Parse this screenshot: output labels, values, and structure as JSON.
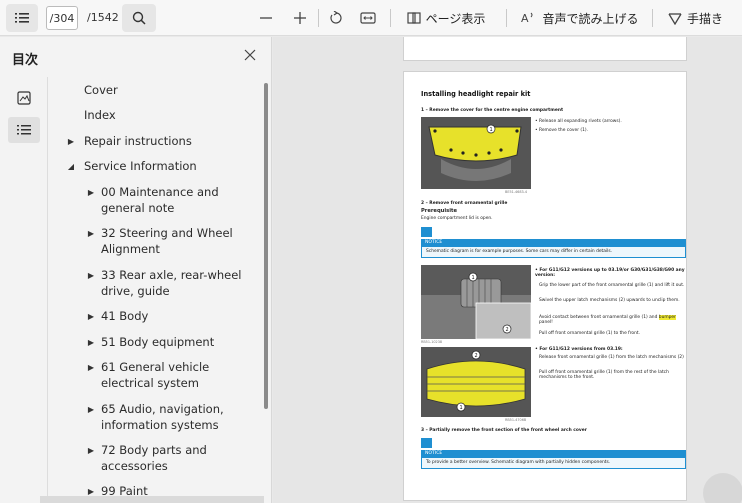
{
  "toolbar": {
    "current_page": "/304",
    "total_pages": "/1542",
    "page_view_label": "ページ表示",
    "read_aloud_label": "音声で読み上げる",
    "draw_label": "手描き"
  },
  "sidebar": {
    "title": "目次",
    "items": [
      {
        "label": "Cover",
        "arrow": ""
      },
      {
        "label": "Index",
        "arrow": ""
      },
      {
        "label": "Repair instructions",
        "arrow": "right"
      },
      {
        "label": "Service Information",
        "arrow": "down"
      },
      {
        "label": "00 Maintenance and general note",
        "line1": "00 Maintenance and",
        "line2": "general note",
        "arrow": "right"
      },
      {
        "label": "32 Steering and Wheel Alignment",
        "line1": "32 Steering and Wheel",
        "line2": "Alignment",
        "arrow": "right"
      },
      {
        "label": "33 Rear axle, rear-wheel drive, guide",
        "line1": "33 Rear axle, rear-wheel",
        "line2": "drive, guide",
        "arrow": "right"
      },
      {
        "label": "41 Body",
        "arrow": "right"
      },
      {
        "label": "51 Body equipment",
        "arrow": "right"
      },
      {
        "label": "61 General vehicle electrical system",
        "line1": "61 General vehicle",
        "line2": "electrical system",
        "arrow": "right"
      },
      {
        "label": "65 Audio, navigation, information systems",
        "line1": "65 Audio, navigation,",
        "line2": "information systems",
        "arrow": "right"
      },
      {
        "label": "72 Body parts and accessories",
        "line1": "72 Body parts and",
        "line2": "accessories",
        "arrow": "right"
      },
      {
        "label": "99 Paint",
        "arrow": "right"
      }
    ]
  },
  "document": {
    "heading": "Installing headlight repair kit",
    "step1": "1 – Remove the cover for the centre engine compartment",
    "step1_b1": "• Release all expanding rivets (arrows).",
    "step1_b2": "• Remove the cover (1).",
    "step2": "2 – Remove front ornamental grille",
    "prereq": "Prerequisite",
    "prereq_text": "Engine compartment lid is open.",
    "notice_label": "NOTICE",
    "notice1": "Schematic diagram is for example purposes. Some cars may differ in certain details.",
    "g11_title": "• For G11/G12 versions up to 03.19/or G30/G31/G38/G90 any version:",
    "g11_a": "Grip the lower part of the front ornamental grille (1) and lift it out.",
    "g11_b": "Swivel the upper latch mechanisms (2) upwards to unclip them.",
    "g11_c_pre": "Avoid contact between front ornamental grille (1) and ",
    "g11_c_hl": "bumper",
    "g11_c_post": " panel!",
    "g11_d": "Pull off front ornamental grille (1) to the front.",
    "g11b_title": "• For G11/G12 versions from 03.19:",
    "g11b_a": "Release front ornamental grille (1) from the latch mechanisms (2)",
    "g11b_b": "Pull off front ornamental grille (1) from the rest of the latch mechanisms to the front.",
    "step3": "3 – Partially remove the front section of the front wheel arch cover",
    "notice2": "To provide a better overview. Schematic diagram with partially hidden components.",
    "caption1": "BE51-4683-4",
    "caption2": "RB51-10238",
    "caption3": "RB51-4706B",
    "mark1": "1",
    "mark2": "2"
  },
  "colors": {
    "notice_blue": "#1f8fd1",
    "highlight_yellow": "#f0ea32",
    "part_yellow": "#e7e12a"
  }
}
